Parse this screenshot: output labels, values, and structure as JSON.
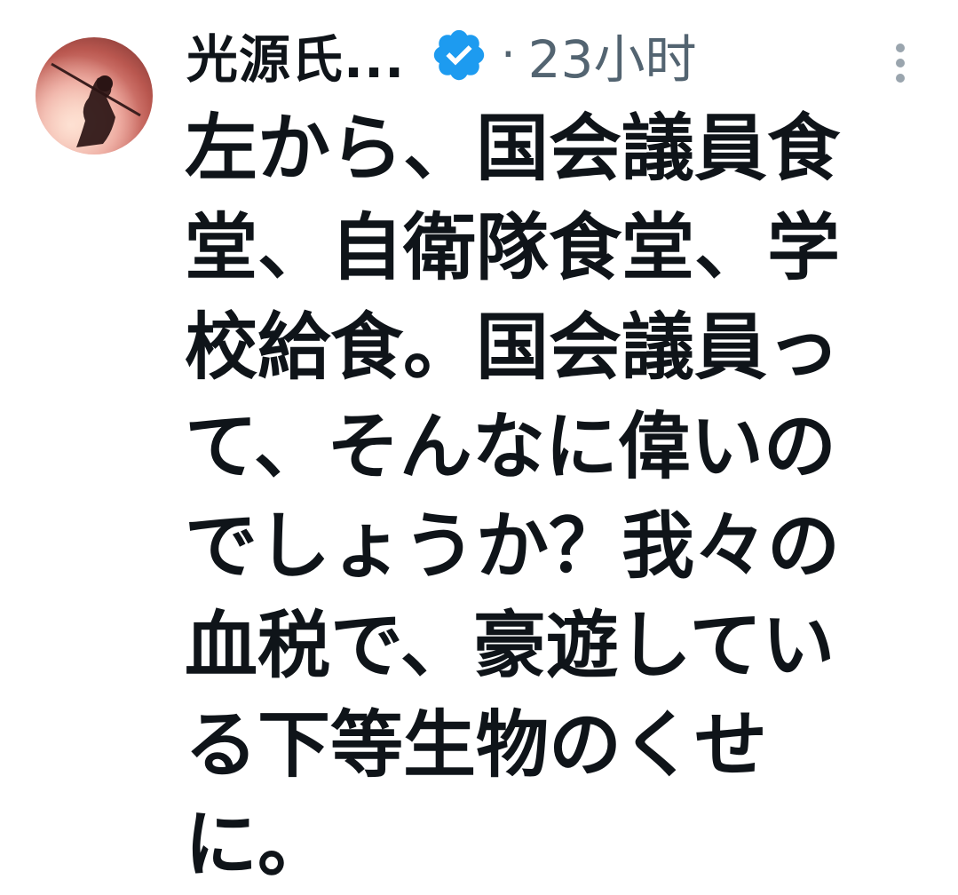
{
  "tweet": {
    "author": {
      "display_name": "光源氏...",
      "verified": true
    },
    "separator": "·",
    "timestamp": "23小时",
    "text_lines": [
      "左から、国会議員食",
      "堂、自衛隊食堂、学",
      "校給食。国会議員っ",
      "て、そんなに偉いの",
      "でしょうか？我々の",
      "血税で、豪遊してい",
      "る下等生物のくせ",
      "に。"
    ]
  },
  "icons": {
    "verified": "verified-badge-icon",
    "more": "more-options-icon"
  },
  "colors": {
    "verified_badge": "#1d9bf0",
    "primary_text": "#0f1419",
    "secondary_text": "#536471"
  }
}
